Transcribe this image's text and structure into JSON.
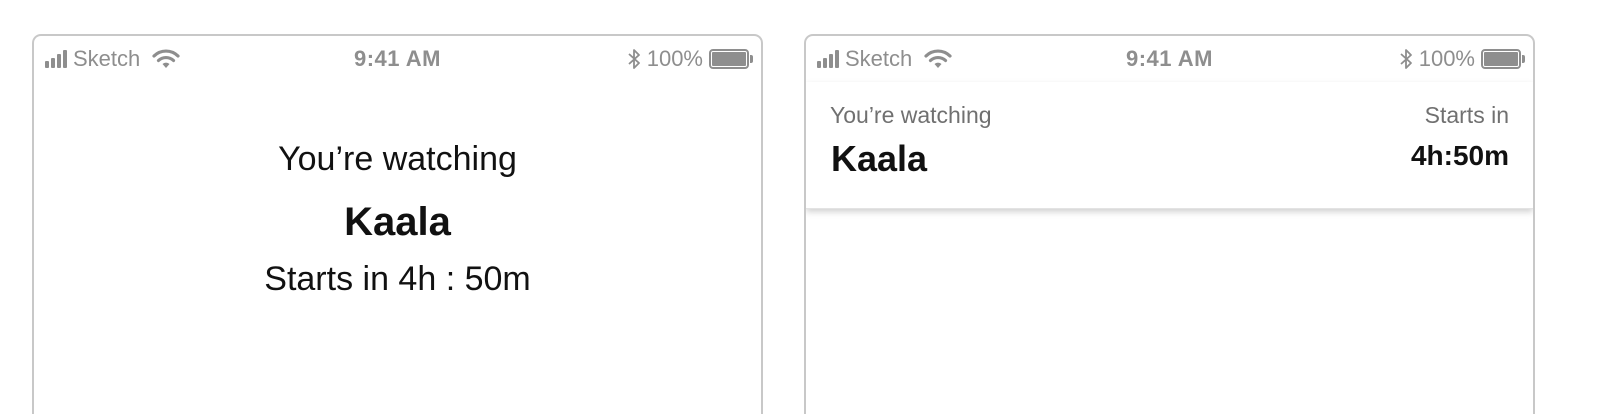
{
  "screens": [
    {
      "status_bar": {
        "carrier": "Sketch",
        "time": "9:41 AM",
        "battery_text": "100%",
        "battery_level": 1.0
      },
      "content": {
        "watching_label": "You’re watching",
        "title": "Kaala",
        "starts_text": "Starts in 4h : 50m"
      }
    },
    {
      "status_bar": {
        "carrier": "Sketch",
        "time": "9:41 AM",
        "battery_text": "100%",
        "battery_level": 1.0
      },
      "banner": {
        "watching_label": "You’re watching",
        "title": "Kaala",
        "starts_in_label": "Starts in",
        "countdown": "4h:50m"
      }
    }
  ],
  "colors": {
    "status_gray": "#8e8e8e",
    "text_dark": "#111111",
    "label_gray": "#707070",
    "frame_border": "#c8c8c8"
  },
  "icons": [
    "cellular-signal-icon",
    "wifi-icon",
    "bluetooth-icon",
    "battery-icon"
  ]
}
